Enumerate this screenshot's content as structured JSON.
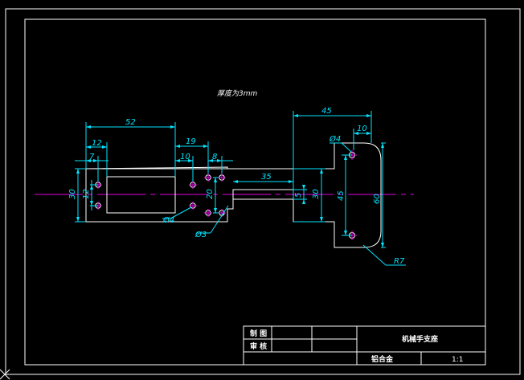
{
  "drawing": {
    "note": "厚度为3mm",
    "title": "机械手支座",
    "material": "铝合金",
    "scale": "1:1",
    "drawn_label": "制 图",
    "checked_label": "审 核"
  },
  "dimensions": {
    "d52": "52",
    "d12": "12",
    "d7": "7",
    "d19": "19",
    "d10a": "10",
    "d8": "8",
    "d45": "45",
    "d10b": "10",
    "d35": "35",
    "d30left": "30",
    "d12v": "12",
    "d20": "20",
    "d5": "5",
    "d30right": "30",
    "d45v": "45",
    "d60": "60",
    "phi4a": "Ø4",
    "phi3": "Ø3",
    "phi4b": "Ø4",
    "r7": "R7"
  },
  "colors": {
    "outline": "#ffffff",
    "dimension": "#00e5ff",
    "centerline": "#e000e0",
    "background": "#000000"
  }
}
